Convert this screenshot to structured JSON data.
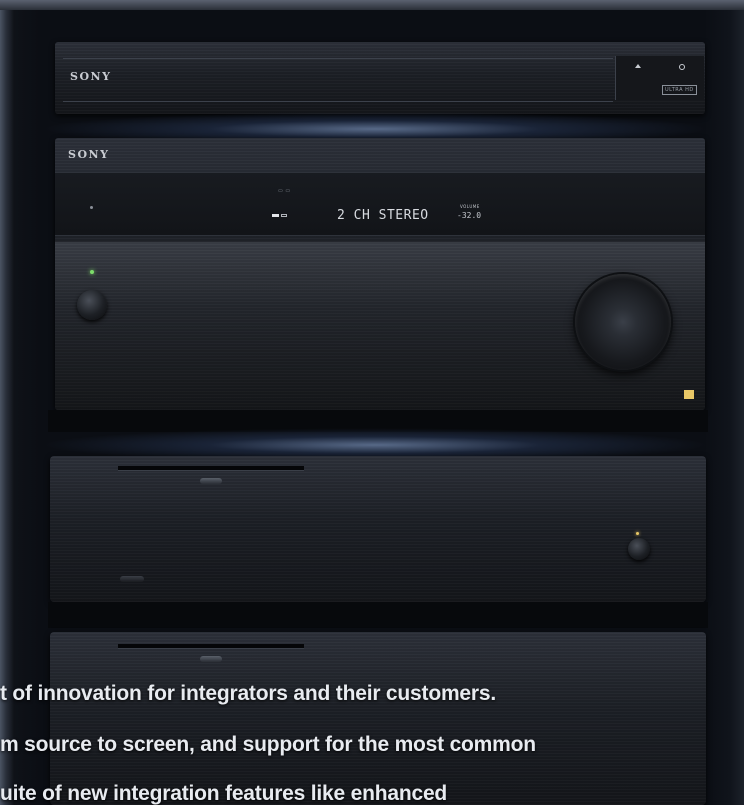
{
  "units": {
    "player": {
      "brand": "SONY",
      "badge": "ULTRA HD"
    },
    "receiver": {
      "brand": "SONY",
      "display_mode": "2 CH STEREO",
      "volume_label": "VOLUME",
      "volume_value": "-32.0"
    }
  },
  "caption": {
    "line1": "t of innovation for integrators and their customers.",
    "line2": "m source to screen, and support for the most common",
    "line3": "uite of new integration features like enhanced"
  },
  "colors": {
    "background": "#0b0e14",
    "led_green": "#7ddc6a",
    "led_amber": "#e8c766",
    "text": "#e8ebf0"
  }
}
